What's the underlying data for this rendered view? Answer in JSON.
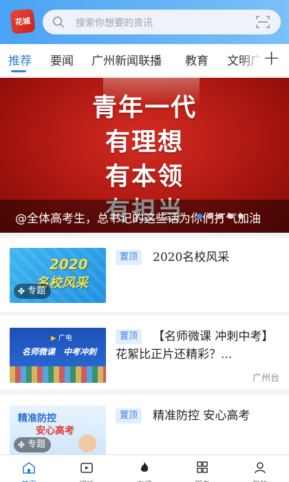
{
  "header": {
    "logo_text": "花城",
    "search_placeholder": "搜索你想要的资讯"
  },
  "tabs": [
    {
      "label": "推荐",
      "active": true
    },
    {
      "label": "要闻",
      "active": false
    },
    {
      "label": "广州新闻联播",
      "active": false
    },
    {
      "label": "教育",
      "active": false
    },
    {
      "label": "文明广",
      "active": false
    }
  ],
  "banner": {
    "lines": [
      "青年一代",
      "有理想",
      "有本领",
      "有担当"
    ],
    "caption": "@全体高考生，总书记的这些话为你们打气加油",
    "slide_count": 5,
    "active_slide": 1
  },
  "list": [
    {
      "pin_label": "置顶",
      "title": "2020名校风采",
      "thumb_text_1": "2020",
      "thumb_text_2": "名校风采",
      "badge": "专题",
      "source": ""
    },
    {
      "pin_label": "置顶",
      "title": "【名师微课 冲刺中考】花絮比正片还精彩？...",
      "thumb_text_1": "名师微课",
      "thumb_text_2": "中考冲刺",
      "thumb_brand": "广电",
      "badge": "",
      "source": "广州台"
    },
    {
      "pin_label": "置顶",
      "title": "精准防控 安心高考",
      "thumb_text_1": "精准防控",
      "thumb_text_2": "安心高考",
      "badge": "专题",
      "source": ""
    }
  ],
  "bottom_nav": [
    {
      "label": "首页",
      "icon": "home-icon",
      "active": true
    },
    {
      "label": "视听",
      "icon": "tv-icon",
      "active": false
    },
    {
      "label": "在播",
      "icon": "flame-icon",
      "active": false
    },
    {
      "label": "服务",
      "icon": "grid-icon",
      "active": false
    },
    {
      "label": "我的",
      "icon": "user-icon",
      "active": false
    }
  ],
  "colors": {
    "accent": "#2f7fd6",
    "banner_red": "#c41f17",
    "header_blue": "#4aa3f5"
  }
}
